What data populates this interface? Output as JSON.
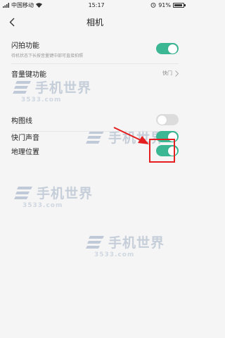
{
  "status_bar": {
    "carrier": "中国移动",
    "time": "15:17",
    "battery": "91%",
    "battery_level": 0.91
  },
  "header": {
    "title": "相机"
  },
  "settings": [
    {
      "label": "闪拍功能",
      "sublabel": "待机状态下长按音量键中部可直接拍照",
      "type": "toggle",
      "on": true
    },
    {
      "label": "音量键功能",
      "value": "快门",
      "type": "link"
    },
    {
      "label": "构图线",
      "type": "toggle",
      "on": false
    },
    {
      "label": "快门声音",
      "type": "toggle",
      "on": true
    },
    {
      "label": "地理位置",
      "type": "toggle",
      "on": true
    }
  ],
  "watermark": {
    "text": "手机世界",
    "sub": "3533.com"
  },
  "colors": {
    "accent": "#3bb794",
    "highlight": "#e51f1f"
  }
}
